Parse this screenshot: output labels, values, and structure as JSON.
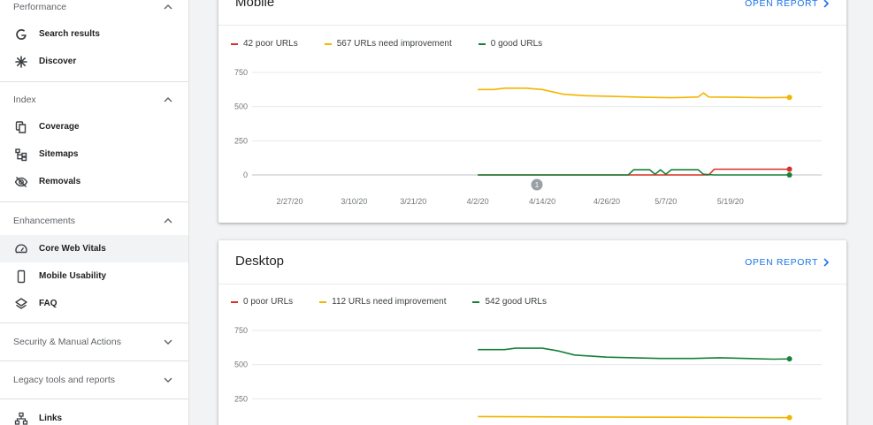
{
  "sidebar": {
    "sections": {
      "performance": {
        "label": "Performance"
      },
      "index": {
        "label": "Index"
      },
      "enhancements": {
        "label": "Enhancements"
      },
      "security": {
        "label": "Security & Manual Actions"
      },
      "legacy": {
        "label": "Legacy tools and reports"
      }
    },
    "items": {
      "search_results": "Search results",
      "discover": "Discover",
      "coverage": "Coverage",
      "sitemaps": "Sitemaps",
      "removals": "Removals",
      "core_web_vitals": "Core Web Vitals",
      "mobile_usability": "Mobile Usability",
      "faq": "FAQ",
      "links": "Links"
    },
    "active_item": "Core Web Vitals"
  },
  "cards": {
    "mobile": {
      "title": "Mobile",
      "open_report": "OPEN REPORT",
      "legend": [
        "42 poor URLs",
        "567 URLs need improvement",
        "0 good URLs"
      ]
    },
    "desktop": {
      "title": "Desktop",
      "open_report": "OPEN REPORT",
      "legend": [
        "0 poor URLs",
        "112 URLs need improvement",
        "542 good URLs"
      ]
    }
  },
  "colors": {
    "poor": "#d93025",
    "needs_improvement": "#f4b400",
    "good": "#188038",
    "accent": "#1a73e8"
  },
  "chart_data": [
    {
      "type": "line",
      "title": "Mobile",
      "x_ticks": [
        "2/27/20",
        "3/10/20",
        "3/21/20",
        "4/2/20",
        "4/14/20",
        "4/26/20",
        "5/7/20",
        "5/19/20"
      ],
      "y_ticks": [
        "750",
        "500",
        "250",
        "0"
      ],
      "ylim": [
        0,
        750
      ],
      "annotation": "1",
      "series": [
        {
          "name": "42 poor URLs",
          "color": "#d93025",
          "x": [
            "4/2/20",
            "4/10/20",
            "4/20/20",
            "4/30/20",
            "5/6/20",
            "5/10/20",
            "5/15/20",
            "5/16/20",
            "5/20/20",
            "5/25/20",
            "5/30/20"
          ],
          "values": [
            0,
            0,
            0,
            0,
            0,
            0,
            0,
            42,
            42,
            42,
            42
          ]
        },
        {
          "name": "567 URLs need improvement",
          "color": "#f4b400",
          "x": [
            "4/2/20",
            "4/5/20",
            "4/7/20",
            "4/11/20",
            "4/14/20",
            "4/18/20",
            "4/22/20",
            "4/27/20",
            "5/3/20",
            "5/8/20",
            "5/13/20",
            "5/14/20",
            "5/15/20",
            "5/20/20",
            "5/25/20",
            "5/30/20"
          ],
          "values": [
            625,
            625,
            635,
            635,
            625,
            590,
            580,
            575,
            568,
            565,
            570,
            600,
            570,
            568,
            565,
            567
          ]
        },
        {
          "name": "0 good URLs",
          "color": "#188038",
          "x": [
            "4/2/20",
            "4/30/20",
            "5/1/20",
            "5/4/20",
            "5/5/20",
            "5/6/20",
            "5/7/20",
            "5/8/20",
            "5/9/20",
            "5/13/20",
            "5/14/20",
            "5/16/20",
            "5/30/20"
          ],
          "values": [
            0,
            0,
            38,
            38,
            5,
            38,
            5,
            38,
            38,
            38,
            5,
            0,
            0
          ]
        }
      ]
    },
    {
      "type": "line",
      "title": "Desktop",
      "y_ticks": [
        "750",
        "500",
        "250"
      ],
      "ylim": [
        0,
        750
      ],
      "series": [
        {
          "name": "0 poor URLs",
          "color": "#d93025",
          "values": []
        },
        {
          "name": "112 URLs need improvement",
          "color": "#f4b400",
          "x": [
            "4/2/20",
            "4/20/20",
            "5/10/20",
            "5/20/20",
            "5/30/20"
          ],
          "values": [
            120,
            117,
            115,
            113,
            112
          ]
        },
        {
          "name": "542 good URLs",
          "color": "#188038",
          "x": [
            "4/2/20",
            "4/7/20",
            "4/9/20",
            "4/14/20",
            "4/17/20",
            "4/20/20",
            "4/26/20",
            "5/1/20",
            "5/6/20",
            "5/12/20",
            "5/17/20",
            "5/22/20",
            "5/27/20",
            "5/30/20"
          ],
          "values": [
            610,
            610,
            620,
            620,
            600,
            570,
            555,
            550,
            545,
            545,
            550,
            545,
            540,
            542
          ]
        }
      ]
    }
  ]
}
